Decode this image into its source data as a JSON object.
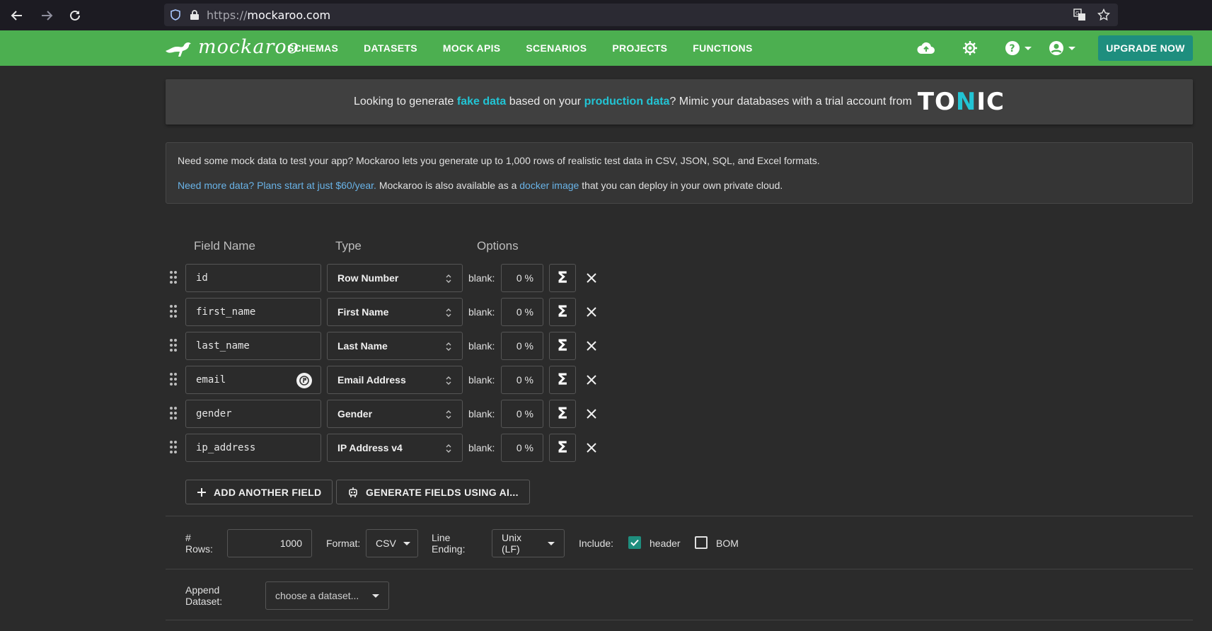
{
  "browser": {
    "url_protocol": "https://",
    "url_host": "mockaroo.com"
  },
  "header": {
    "logo_text": "mockaroo",
    "nav": [
      "SCHEMAS",
      "DATASETS",
      "MOCK APIS",
      "SCENARIOS",
      "PROJECTS",
      "FUNCTIONS"
    ],
    "upgrade_label": "UPGRADE NOW",
    "colors": {
      "header_bg": "#4caf50",
      "upgrade_bg": "#1e8e7e",
      "accent": "#22c4d4"
    }
  },
  "banner": {
    "text_1": "Looking to generate ",
    "link_1": "fake data",
    "text_2": " based on your ",
    "link_2": "production data",
    "text_3": "? Mimic your databases with a trial account from",
    "logo_a": "TO",
    "logo_n": "N",
    "logo_b": "IC"
  },
  "info": {
    "line1": "Need some mock data to test your app? Mockaroo lets you generate up to 1,000 rows of realistic test data in CSV, JSON, SQL, and Excel formats.",
    "link_plans": "Need more data? Plans start at just $60/year.",
    "text_mid": " Mockaroo is also available as a ",
    "link_docker": "docker image",
    "text_end": " that you can deploy in your own private cloud."
  },
  "table": {
    "col_field": "Field Name",
    "col_type": "Type",
    "col_options": "Options",
    "blank_label": "blank:",
    "sigma": "Σ",
    "rows": [
      {
        "name": "id",
        "type": "Row Number",
        "blank": "0 %"
      },
      {
        "name": "first_name",
        "type": "First Name",
        "blank": "0 %"
      },
      {
        "name": "last_name",
        "type": "Last Name",
        "blank": "0 %"
      },
      {
        "name": "email",
        "type": "Email Address",
        "blank": "0 %"
      },
      {
        "name": "gender",
        "type": "Gender",
        "blank": "0 %"
      },
      {
        "name": "ip_address",
        "type": "IP Address v4",
        "blank": "0 %"
      }
    ]
  },
  "actions": {
    "add_field": "ADD ANOTHER FIELD",
    "generate_ai": "GENERATE FIELDS USING AI..."
  },
  "options": {
    "rows_label": "# Rows:",
    "rows_value": "1000",
    "format_label": "Format:",
    "format_value": "CSV",
    "line_ending_label": "Line Ending:",
    "line_ending_value": "Unix (LF)",
    "include_label": "Include:",
    "header_label": "header",
    "header_checked": true,
    "bom_label": "BOM",
    "bom_checked": false,
    "append_label": "Append Dataset:",
    "append_placeholder": "choose a dataset..."
  }
}
